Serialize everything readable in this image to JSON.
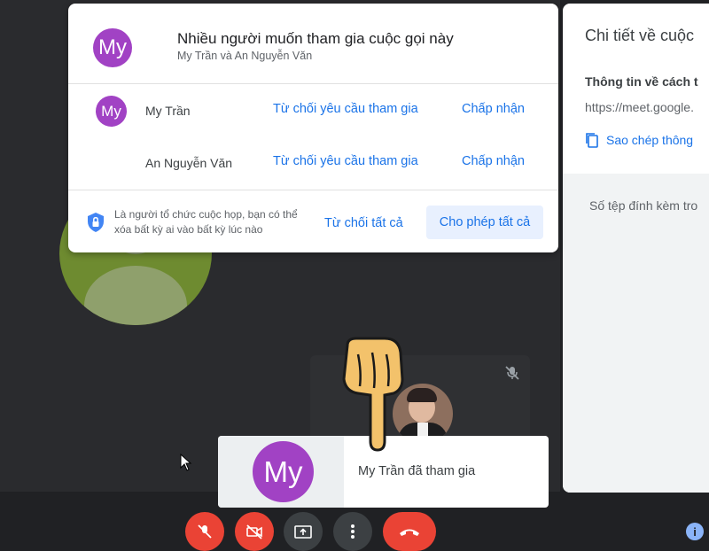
{
  "dialog": {
    "avatar_initials": "My",
    "title": "Nhiều người muốn tham gia cuộc gọi này",
    "subtitle": "My Trần và An Nguyễn Văn",
    "requests": [
      {
        "initials": "My",
        "name": "My Trần",
        "deny_label": "Từ chối yêu cầu tham gia",
        "accept_label": "Chấp nhận"
      },
      {
        "initials": "",
        "name": "An Nguyễn Văn",
        "deny_label": "Từ chối yêu cầu tham gia",
        "accept_label": "Chấp nhận"
      }
    ],
    "host_note": "Là người tổ chức cuộc họp, bạn có thể xóa bất kỳ ai vào bất kỳ lúc nào",
    "deny_all_label": "Từ chối tất cả",
    "allow_all_label": "Cho phép tất cả"
  },
  "side_panel": {
    "title": "Chi tiết về cuộc",
    "join_info_heading": "Thông tin về cách t",
    "meeting_url": "https://meet.google.",
    "copy_label": "Sao chép thông",
    "attachments_label": "Số tệp đính kèm tro"
  },
  "toast": {
    "avatar_initials": "My",
    "message": "My Trần đã tham gia"
  },
  "controls": {
    "info_glyph": "i"
  },
  "colors": {
    "accent": "#1a73e8",
    "avatar_purple": "#a142c4",
    "control_red": "#ea4335",
    "background": "#202124"
  }
}
